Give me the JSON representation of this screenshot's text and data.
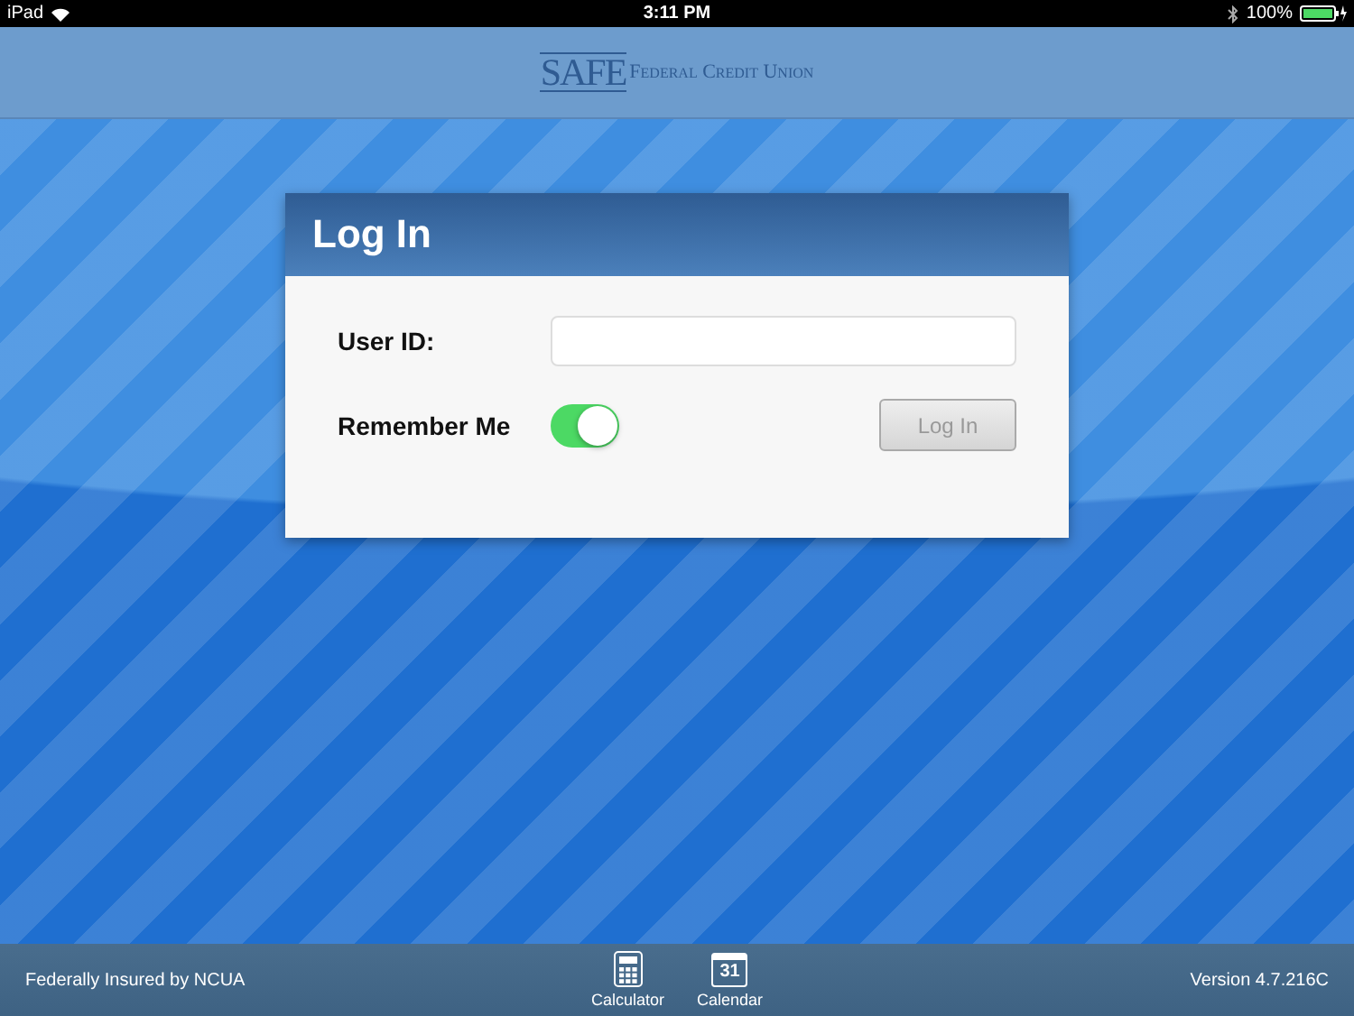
{
  "status_bar": {
    "device": "iPad",
    "time": "3:11 PM",
    "battery": "100%"
  },
  "header": {
    "logo_mark": "SAFE",
    "logo_text": "Federal Credit Union"
  },
  "login_card": {
    "title": "Log In",
    "user_id": {
      "label": "User ID:"
    },
    "remember_me": {
      "label": "Remember Me",
      "on": true
    },
    "login_button": {
      "label": "Log In",
      "disabled": true
    }
  },
  "footer": {
    "left_text": "Federally Insured by NCUA",
    "tools": [
      {
        "kind": "calculator",
        "label": "Calculator"
      },
      {
        "kind": "calendar",
        "label": "Calendar",
        "day": "31"
      }
    ],
    "version": "Version 4.7.216C"
  }
}
